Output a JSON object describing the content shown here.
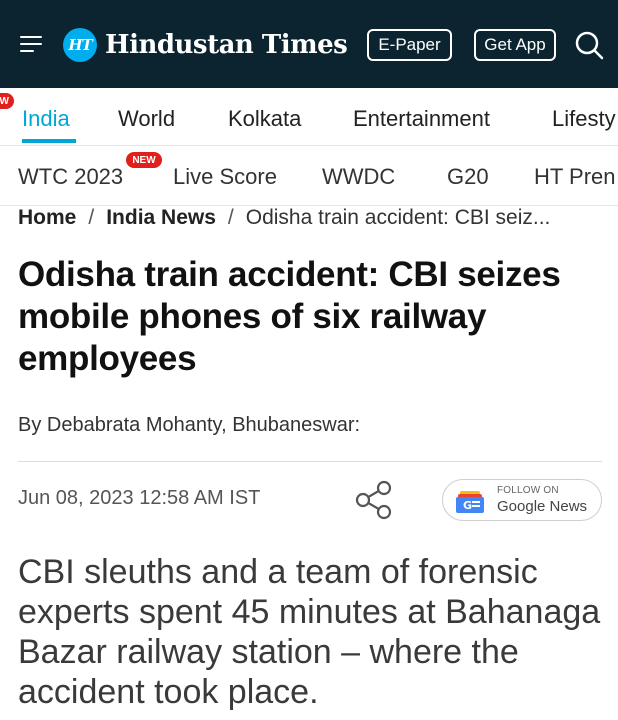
{
  "header": {
    "logo_mark": "HT",
    "logo_text": "Hindustan Times",
    "epaper_label": "E-Paper",
    "getapp_label": "Get App",
    "icons": [
      "menu-icon",
      "search-icon"
    ]
  },
  "primary_nav": {
    "badge": "W",
    "items": [
      "India",
      "World",
      "Kolkata",
      "Entertainment",
      "Lifesty"
    ],
    "active": "India"
  },
  "secondary_nav": {
    "items": [
      "WTC 2023",
      "Live Score",
      "WWDC",
      "G20",
      "HT Pren"
    ],
    "new_badge": "NEW"
  },
  "breadcrumb": {
    "home": "Home",
    "separator": "/",
    "section": "India News",
    "current": "Odisha train accident: CBI seiz..."
  },
  "article": {
    "headline": "Odisha train accident: CBI seizes mobile phones of six railway employees",
    "byline": "By Debabrata Mohanty, Bhubaneswar:",
    "date": "Jun 08, 2023 12:58 AM IST",
    "summary": "CBI sleuths and a team of forensic experts spent 45 minutes at Bahanaga Bazar railway station – where the accident took place."
  },
  "google_news": {
    "follow_label": "FOLLOW ON",
    "name": "Google News"
  },
  "colors": {
    "header_bg": "#0b2430",
    "accent": "#00a6d6",
    "badge_red": "#e0201c"
  }
}
